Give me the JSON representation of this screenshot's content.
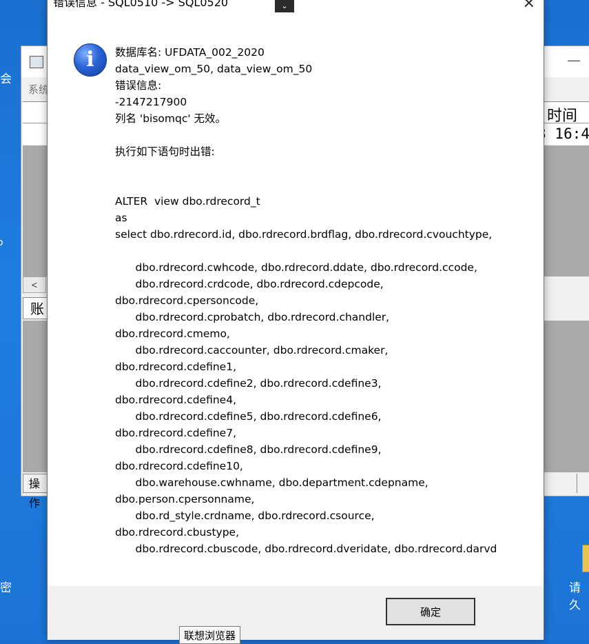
{
  "desktop": {
    "label_top_left": "会",
    "label_mid_left": "o",
    "label_bottom_left": "密",
    "label_bottom_right": "请久"
  },
  "background_window": {
    "menu_text": "系统",
    "grid_header": "时间",
    "grid_value": "3 16:4",
    "scroll_left": "<",
    "account_label": "账",
    "operation_label": "操作",
    "minimize_glyph": "—"
  },
  "dialog": {
    "title": "错误信息 - SQL0510 -> SQL0520",
    "close_glyph": "✕",
    "chevron_glyph": "⌄",
    "info_glyph": "i",
    "message_lines": [
      "数据库名: UFDATA_002_2020",
      "data_view_om_50, data_view_om_50",
      "错误信息:",
      "-2147217900",
      "列名 'bisomqc' 无效。",
      "",
      "执行如下语句时出错:",
      "",
      "",
      "ALTER  view dbo.rdrecord_t",
      "as",
      "select dbo.rdrecord.id, dbo.rdrecord.brdflag, dbo.rdrecord.cvouchtype,",
      "",
      "      dbo.rdrecord.cwhcode, dbo.rdrecord.ddate, dbo.rdrecord.ccode,",
      "      dbo.rdrecord.crdcode, dbo.rdrecord.cdepcode,",
      "dbo.rdrecord.cpersoncode,",
      "      dbo.rdrecord.cprobatch, dbo.rdrecord.chandler,",
      "dbo.rdrecord.cmemo,",
      "      dbo.rdrecord.caccounter, dbo.rdrecord.cmaker,",
      "dbo.rdrecord.cdefine1,",
      "      dbo.rdrecord.cdefine2, dbo.rdrecord.cdefine3,",
      "dbo.rdrecord.cdefine4,",
      "      dbo.rdrecord.cdefine5, dbo.rdrecord.cdefine6,",
      "dbo.rdrecord.cdefine7,",
      "      dbo.rdrecord.cdefine8, dbo.rdrecord.cdefine9,",
      "dbo.rdrecord.cdefine10,",
      "      dbo.warehouse.cwhname, dbo.department.cdepname,",
      "dbo.person.cpersonname,",
      "      dbo.rd_style.crdname, dbo.rdrecord.csource,",
      "dbo.rdrecord.cbustype,",
      "      dbo.rdrecord.cbuscode, dbo.rdrecord.dveridate, dbo.rdrecord.darvd"
    ],
    "ok_label": "确定"
  },
  "tooltip": {
    "text": "联想浏览器"
  }
}
